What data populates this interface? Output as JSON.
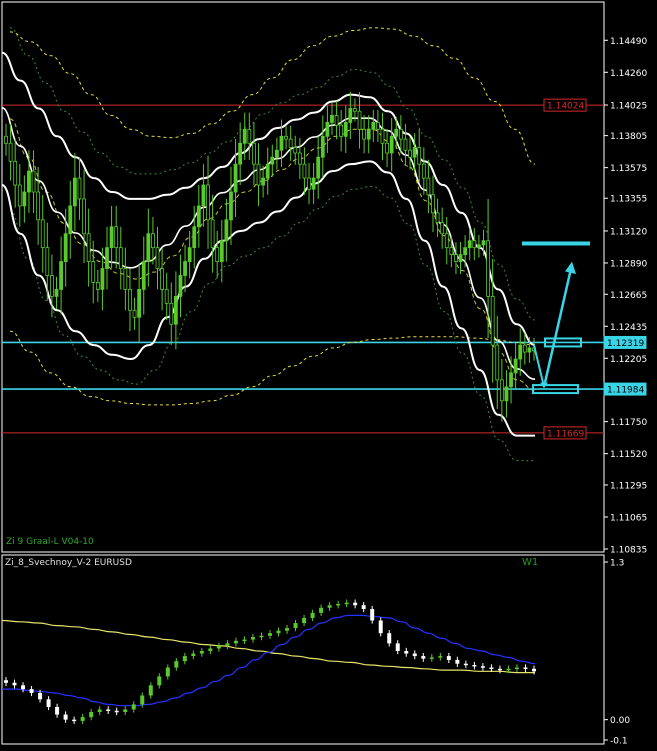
{
  "main_panel": {
    "indicator_label": "Zi 9 Graal-L V04-10",
    "timeframe_label": "W1"
  },
  "sub_panel": {
    "indicator_label": "Zi_8_Svechnoy_V-2 EURUSD",
    "ticks": [
      "1.3",
      "0.00",
      "-0.1"
    ]
  },
  "colors": {
    "background": "#000000",
    "grid_axis": "#ffffff",
    "candle": "#59c92e",
    "envelope": "#ffffff",
    "outer_band": "#e6e03a",
    "inner_band": "#3a8a3a",
    "support_line": "#39d5e6",
    "resistance_line": "#d42a2a",
    "sub_blue": "#2433ff",
    "sub_yellow": "#e6e36a"
  },
  "chart_data": [
    {
      "type": "candlestick",
      "name": "main",
      "y_ticks": [
        "1.14490",
        "1.14260",
        "1.14025",
        "1.13805",
        "1.13575",
        "1.13355",
        "1.13120",
        "1.12890",
        "1.12665",
        "1.12435",
        "1.12205",
        "1.11980",
        "1.11750",
        "1.11520",
        "1.11295",
        "1.11065",
        "1.10835"
      ],
      "ylim": [
        1.10835,
        1.1465
      ],
      "level_labels": [
        {
          "value": 1.14024,
          "label": "1.14024",
          "kind": "resistance"
        },
        {
          "value": 1.12319,
          "label": "1.12319",
          "kind": "support"
        },
        {
          "value": 1.11984,
          "label": "1.11984",
          "kind": "support"
        },
        {
          "value": 1.11669,
          "label": "1.11669",
          "kind": "resistance"
        }
      ],
      "close": [
        1.1375,
        1.1362,
        1.1345,
        1.133,
        1.134,
        1.1355,
        1.134,
        1.132,
        1.13,
        1.128,
        1.1265,
        1.127,
        1.129,
        1.131,
        1.133,
        1.135,
        1.1335,
        1.131,
        1.129,
        1.1275,
        1.127,
        1.1285,
        1.13,
        1.1315,
        1.13,
        1.1285,
        1.127,
        1.1255,
        1.125,
        1.127,
        1.129,
        1.131,
        1.13,
        1.1285,
        1.127,
        1.126,
        1.1245,
        1.1265,
        1.128,
        1.129,
        1.13,
        1.1315,
        1.133,
        1.1345,
        1.132,
        1.13,
        1.129,
        1.1305,
        1.132,
        1.134,
        1.136,
        1.1375,
        1.1385,
        1.1375,
        1.136,
        1.1345,
        1.135,
        1.136,
        1.1365,
        1.137,
        1.138,
        1.1378,
        1.1372,
        1.1368,
        1.136,
        1.135,
        1.1342,
        1.135,
        1.1365,
        1.138,
        1.139,
        1.1395,
        1.1388,
        1.138,
        1.139,
        1.14,
        1.1398,
        1.1385,
        1.1378,
        1.1385,
        1.139,
        1.1385,
        1.1375,
        1.1368,
        1.138,
        1.1385,
        1.1378,
        1.137,
        1.1365,
        1.1372,
        1.136,
        1.135,
        1.1338,
        1.1325,
        1.1318,
        1.131,
        1.13,
        1.1295,
        1.129,
        1.1295,
        1.13,
        1.1305,
        1.13,
        1.1302,
        1.1305,
        1.1265,
        1.123,
        1.1205,
        1.119,
        1.12,
        1.121,
        1.122,
        1.123,
        1.1225,
        1.1228,
        1.1226
      ],
      "channel_upper": [
        1.144,
        1.142,
        1.14,
        1.138,
        1.1365,
        1.135,
        1.134,
        1.1335,
        1.1335,
        1.1338,
        1.1343,
        1.135,
        1.1358,
        1.1368,
        1.1378,
        1.1386,
        1.1392,
        1.1397,
        1.1405,
        1.141,
        1.1408,
        1.1398,
        1.1382,
        1.1362,
        1.1345,
        1.1325,
        1.13,
        1.127,
        1.1245,
        1.123
      ],
      "channel_lower": [
        1.1345,
        1.131,
        1.128,
        1.1255,
        1.124,
        1.123,
        1.1223,
        1.122,
        1.123,
        1.125,
        1.1272,
        1.1292,
        1.1305,
        1.1312,
        1.1318,
        1.1326,
        1.1336,
        1.1346,
        1.1355,
        1.136,
        1.1362,
        1.1354,
        1.1335,
        1.1305,
        1.1272,
        1.1242,
        1.1212,
        1.118,
        1.1165,
        1.1165
      ],
      "band_outer_upper": [
        1.1455,
        1.1448,
        1.1438,
        1.1425,
        1.141,
        1.1395,
        1.1385,
        1.138,
        1.1379,
        1.1382,
        1.1389,
        1.1398,
        1.141,
        1.1422,
        1.1435,
        1.1445,
        1.1452,
        1.1456,
        1.1458,
        1.1457,
        1.1452,
        1.1445,
        1.1436,
        1.1422,
        1.1405,
        1.1385,
        1.136
      ],
      "band_outer_lower": [
        1.124,
        1.1225,
        1.121,
        1.12,
        1.1193,
        1.119,
        1.1188,
        1.1187,
        1.1187,
        1.1188,
        1.119,
        1.1194,
        1.12,
        1.1208,
        1.1215,
        1.1222,
        1.1228,
        1.1232,
        1.1234,
        1.1235,
        1.1236,
        1.1236,
        1.1236,
        1.1235,
        1.1234,
        1.1232,
        1.123
      ]
    },
    {
      "type": "candlestick",
      "name": "sub",
      "ylim": [
        -0.1,
        1.3
      ],
      "close": [
        0.35,
        0.33,
        0.3,
        0.27,
        0.22,
        0.16,
        0.1,
        0.06,
        0.05,
        0.08,
        0.12,
        0.14,
        0.13,
        0.12,
        0.14,
        0.18,
        0.25,
        0.33,
        0.4,
        0.47,
        0.52,
        0.56,
        0.58,
        0.6,
        0.62,
        0.64,
        0.66,
        0.68,
        0.69,
        0.71,
        0.72,
        0.74,
        0.76,
        0.78,
        0.82,
        0.86,
        0.9,
        0.94,
        0.96,
        0.97,
        0.98,
        0.96,
        0.93,
        0.84,
        0.74,
        0.66,
        0.6,
        0.58,
        0.56,
        0.54,
        0.55,
        0.56,
        0.53,
        0.5,
        0.49,
        0.48,
        0.47,
        0.46,
        0.45,
        0.46,
        0.47,
        0.46,
        0.44
      ],
      "blue_line": [
        0.3,
        0.3,
        0.29,
        0.28,
        0.27,
        0.25,
        0.23,
        0.2,
        0.18,
        0.17,
        0.17,
        0.18,
        0.2,
        0.23,
        0.27,
        0.31,
        0.36,
        0.41,
        0.47,
        0.53,
        0.59,
        0.65,
        0.71,
        0.77,
        0.82,
        0.86,
        0.88,
        0.88,
        0.87,
        0.86,
        0.83,
        0.78,
        0.74,
        0.7,
        0.66,
        0.62,
        0.6,
        0.57,
        0.55,
        0.52,
        0.5
      ],
      "yellow_line": [
        0.84,
        0.83,
        0.82,
        0.8,
        0.79,
        0.77,
        0.75,
        0.73,
        0.71,
        0.69,
        0.67,
        0.65,
        0.64,
        0.62,
        0.6,
        0.58,
        0.56,
        0.54,
        0.52,
        0.51,
        0.49,
        0.48,
        0.47,
        0.46,
        0.45,
        0.45,
        0.44,
        0.44,
        0.43,
        0.43
      ]
    }
  ]
}
